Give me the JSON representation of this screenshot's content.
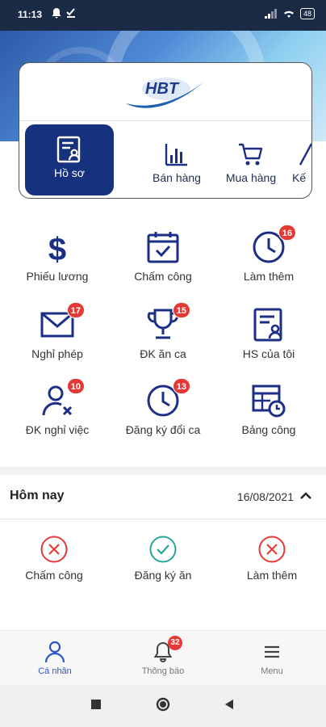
{
  "status_bar": {
    "time": "11:13",
    "battery": "48"
  },
  "app": {
    "logo_text": "HBT",
    "colors": {
      "primary": "#16317e",
      "icon": "#1c2f86",
      "badge": "#e53935",
      "ok": "#26a69a",
      "error": "#e53935",
      "nav_active": "#2a56c6"
    }
  },
  "modules": [
    {
      "label": "Hồ sơ",
      "icon": "profile-doc-icon",
      "active": true
    },
    {
      "label": "Bán hàng",
      "icon": "bar-chart-icon"
    },
    {
      "label": "Mua hàng",
      "icon": "cart-icon"
    },
    {
      "label": "Kế",
      "icon": "accounting-icon"
    }
  ],
  "grid": [
    {
      "label": "Phiếu lương",
      "icon": "dollar-icon"
    },
    {
      "label": "Chấm công",
      "icon": "calendar-check-icon"
    },
    {
      "label": "Làm thêm",
      "icon": "clock-icon",
      "badge": "16"
    },
    {
      "label": "Nghỉ phép",
      "icon": "mail-icon",
      "badge": "17"
    },
    {
      "label": "ĐK ăn ca",
      "icon": "trophy-icon",
      "badge": "15"
    },
    {
      "label": "HS của tôi",
      "icon": "profile-doc-icon"
    },
    {
      "label": "ĐK nghỉ việc",
      "icon": "user-remove-icon",
      "badge": "10"
    },
    {
      "label": "Đăng ký đổi ca",
      "icon": "clock-icon",
      "badge": "13"
    },
    {
      "label": "Bảng công",
      "icon": "table-clock-icon"
    }
  ],
  "today": {
    "title": "Hôm nay",
    "date": "16/08/2021",
    "items": [
      {
        "label": "Chấm công",
        "status": "error"
      },
      {
        "label": "Đăng ký ăn",
        "status": "ok"
      },
      {
        "label": "Làm thêm",
        "status": "error"
      }
    ]
  },
  "bottom_nav": [
    {
      "label": "Cá nhân",
      "icon": "person-icon",
      "active": true
    },
    {
      "label": "Thông báo",
      "icon": "bell-icon",
      "badge": "32"
    },
    {
      "label": "Menu",
      "icon": "menu-icon"
    }
  ]
}
